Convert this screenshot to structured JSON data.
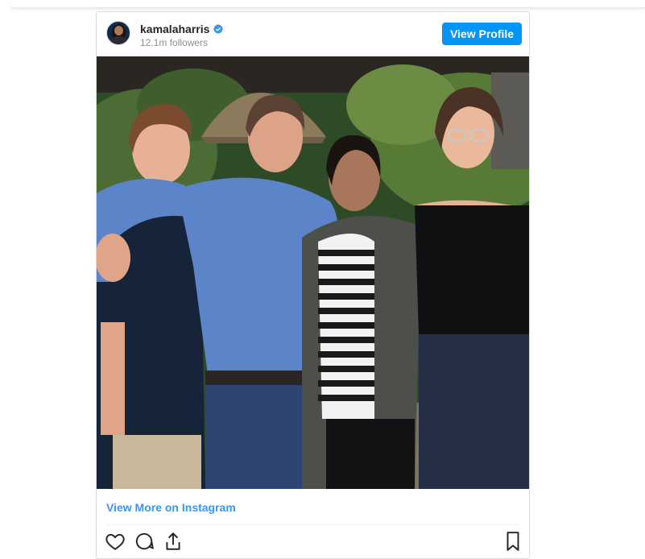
{
  "profile": {
    "username": "kamalaharris",
    "followers": "12.1m followers",
    "view_profile_label": "View Profile",
    "verified": true
  },
  "post": {
    "view_more_label": "View More on Instagram",
    "photo_alt": ""
  },
  "icons": {
    "like": "heart-icon",
    "comment": "comment-icon",
    "share": "share-icon",
    "save": "bookmark-icon",
    "verified": "verified-badge-icon"
  },
  "colors": {
    "accent": "#0095f6",
    "link": "#3897f0",
    "verified": "#3897f0",
    "username": "#262626",
    "muted": "#8e8e8e",
    "border": "#dbdbdb"
  }
}
